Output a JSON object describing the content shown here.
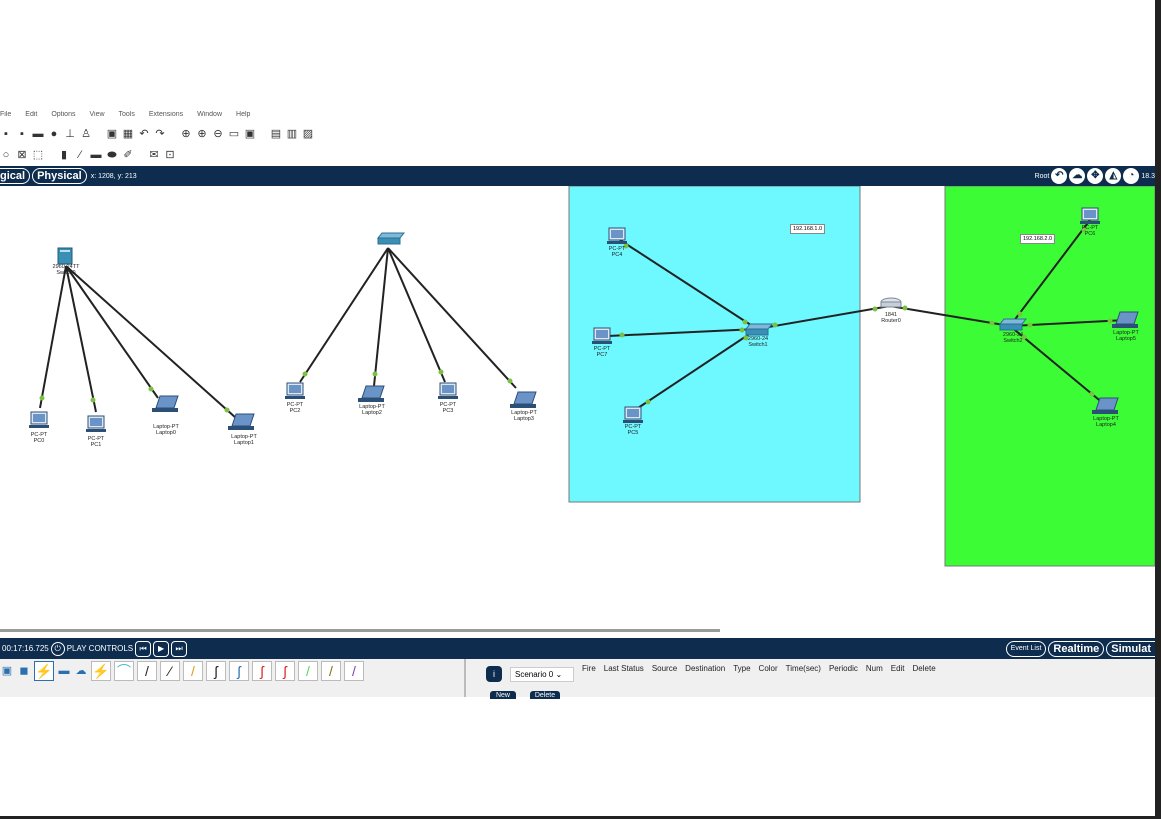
{
  "menu": [
    "File",
    "Edit",
    "Options",
    "View",
    "Tools",
    "Extensions",
    "Window",
    "Help"
  ],
  "view_tabs": {
    "logical": "gical",
    "physical": "Physical"
  },
  "coords": "x: 1208, y: 213",
  "root_label": "Root",
  "zoom_partial": "18.3",
  "clusters": [
    {
      "id": "left",
      "switch_label": "2960-24TT\nSwitch0",
      "devices": [
        {
          "type": "pc",
          "label": "PC-PT\nPC0"
        },
        {
          "type": "pc",
          "label": "PC-PT\nPC1"
        },
        {
          "type": "laptop",
          "label": "Laptop-PT\nLaptop0"
        },
        {
          "type": "laptop",
          "label": "Laptop-PT\nLaptop1"
        }
      ]
    },
    {
      "id": "mid",
      "switch_label": "",
      "devices": [
        {
          "type": "pc",
          "label": "PC-PT\nPC2"
        },
        {
          "type": "laptop",
          "label": "Laptop-PT\nLaptop2"
        },
        {
          "type": "pc",
          "label": "PC-PT\nPC3"
        },
        {
          "type": "laptop",
          "label": "Laptop-PT\nLaptop3"
        }
      ]
    }
  ],
  "network1": {
    "ip": "192.168.1.0",
    "switch_label": "2960-24\nSwitch1",
    "color": "#6ef8ff",
    "devices": [
      {
        "type": "pc",
        "label": "PC-PT\nPC4"
      },
      {
        "type": "pc",
        "label": "PC-PT\nPC7"
      },
      {
        "type": "pc",
        "label": "PC-PT\nPC5"
      }
    ]
  },
  "router": {
    "label": "1841\nRouter0"
  },
  "network2": {
    "ip": "192.168.2.0",
    "switch_label": "2960-24\nSwitch2",
    "color": "#3cfd35",
    "devices": [
      {
        "type": "pc",
        "label": "PC-PT\nPC6"
      },
      {
        "type": "laptop",
        "label": "Laptop-PT\nLaptop5"
      },
      {
        "type": "laptop",
        "label": "Laptop-PT\nLaptop4"
      }
    ]
  },
  "bottom": {
    "time": "00:17:16.725",
    "play_controls": "PLAY CONTROLS",
    "event_list": "Event List",
    "realtime": "Realtime",
    "simulation": "Simulat"
  },
  "scenario": {
    "select": "Scenario 0",
    "new": "New",
    "delete": "Delete"
  },
  "event_columns": [
    "Fire",
    "Last Status",
    "Source",
    "Destination",
    "Type",
    "Color",
    "Time(sec)",
    "Periodic",
    "Num",
    "Edit",
    "Delete"
  ],
  "colors": {
    "dark_bar": "#0d2c4e",
    "link": "#222",
    "link_dot": "#7ac142"
  }
}
